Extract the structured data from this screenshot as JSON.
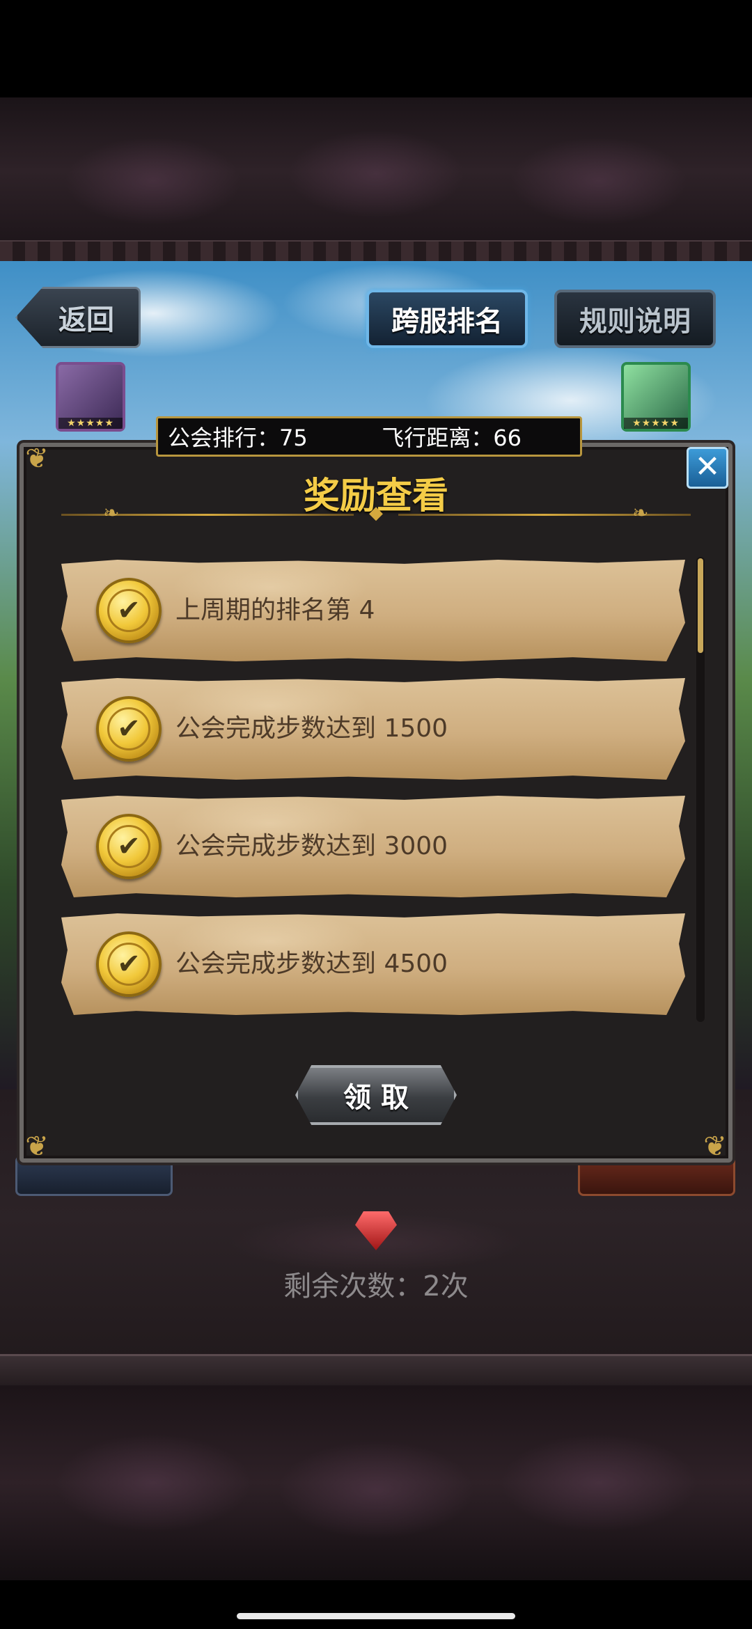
{
  "nav": {
    "back_label": "返回",
    "tab_ranking_label": "跨服排名",
    "tab_rules_label": "规则说明"
  },
  "info_bar": {
    "guild_rank_label": "公会排行：75",
    "flight_distance_label": "飞行距离：66"
  },
  "panel": {
    "title": "奖励查看",
    "close_label": "✕"
  },
  "rewards": [
    {
      "label": "上周期的排名第 4",
      "claimed": true
    },
    {
      "label": "公会完成步数达到 1500",
      "claimed": true
    },
    {
      "label": "公会完成步数达到 3000",
      "claimed": true
    },
    {
      "label": "公会完成步数达到 4500",
      "claimed": true
    }
  ],
  "claim_button_label": "领取",
  "remaining_label": "剩余次数：2次",
  "colors": {
    "title_gold": "#f4cc47",
    "active_tab_glow": "#6fb7e8",
    "parchment": "#cfae80",
    "badge_gold": "#f1c83a"
  },
  "icons": {
    "back": "arrow-left-icon",
    "close": "close-icon",
    "check": "check-icon",
    "gem": "gem-icon"
  }
}
